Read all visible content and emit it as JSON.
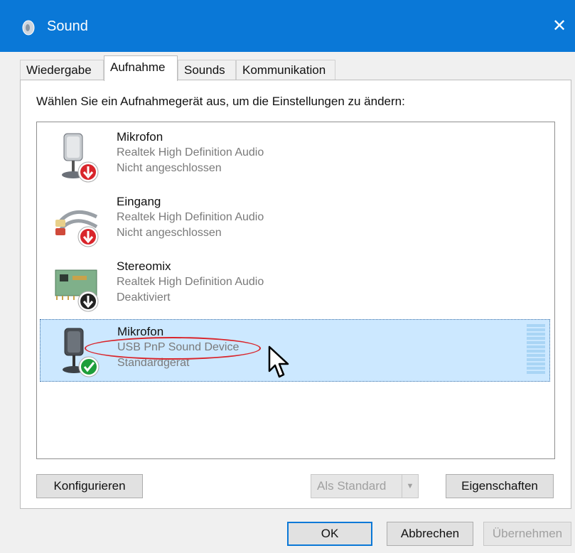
{
  "window": {
    "title": "Sound",
    "icon": "speaker-icon",
    "close_glyph": "✕"
  },
  "tabs": [
    {
      "label": "Wiedergabe",
      "active": false
    },
    {
      "label": "Aufnahme",
      "active": true
    },
    {
      "label": "Sounds",
      "active": false
    },
    {
      "label": "Kommunikation",
      "active": false
    }
  ],
  "panel": {
    "instruction": "Wählen Sie ein Aufnahmegerät aus, um die Einstellungen zu ändern:"
  },
  "devices": [
    {
      "name": "Mikrofon",
      "driver": "Realtek High Definition Audio",
      "status": "Nicht angeschlossen",
      "icon": "microphone-icon",
      "badge": "unplugged-red-arrow"
    },
    {
      "name": "Eingang",
      "driver": "Realtek High Definition Audio",
      "status": "Nicht angeschlossen",
      "icon": "line-in-cable-icon",
      "badge": "unplugged-red-arrow"
    },
    {
      "name": "Stereomix",
      "driver": "Realtek High Definition Audio",
      "status": "Deaktiviert",
      "icon": "sound-card-icon",
      "badge": "disabled-black-arrow"
    },
    {
      "name": "Mikrofon",
      "driver": "USB PnP Sound Device",
      "status": "Standardgerät",
      "icon": "microphone-icon",
      "badge": "default-green-check",
      "selected": true
    }
  ],
  "buttons": {
    "configure": "Konfigurieren",
    "set_default": "Als Standard",
    "properties": "Eigenschaften",
    "ok": "OK",
    "cancel": "Abbrechen",
    "apply": "Übernehmen"
  },
  "colors": {
    "titlebar": "#0a78d7",
    "selection": "#cce8ff",
    "annotation": "#d9252b",
    "unplugged_badge": "#d9252b",
    "default_badge": "#1e9e3a"
  }
}
